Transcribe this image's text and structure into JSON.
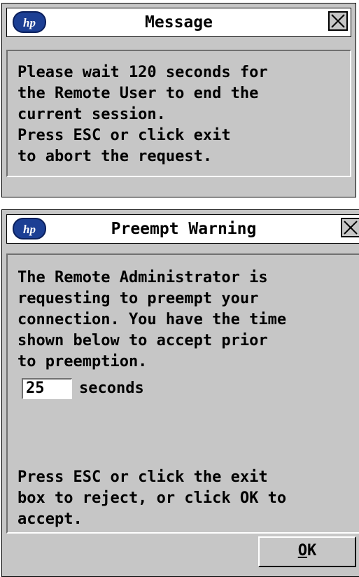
{
  "message_dialog": {
    "title": "Message",
    "logo_icon": "hp-logo-icon",
    "close_icon": "close-x-icon",
    "body_lines": [
      "Please wait 120 seconds for",
      "the Remote User to end the",
      "current session.",
      "Press ESC or click exit",
      "to abort the request."
    ]
  },
  "preempt_dialog": {
    "title": "Preempt Warning",
    "logo_icon": "hp-logo-icon",
    "close_icon": "close-x-icon",
    "body_lines": [
      "The Remote Administrator is",
      "requesting to preempt your",
      "connection. You have the time",
      "shown below to accept prior",
      "to preemption."
    ],
    "countdown_value": "25",
    "countdown_unit": "seconds",
    "footer_lines": [
      "Press ESC or click the exit",
      "box to reject, or click OK to",
      "accept."
    ],
    "ok_mnemonic": "O",
    "ok_rest": "K"
  },
  "colors": {
    "dialog_bg": "#c6c6c6",
    "title_bg": "#ffffff",
    "logo_blue": "#1c3f94"
  }
}
